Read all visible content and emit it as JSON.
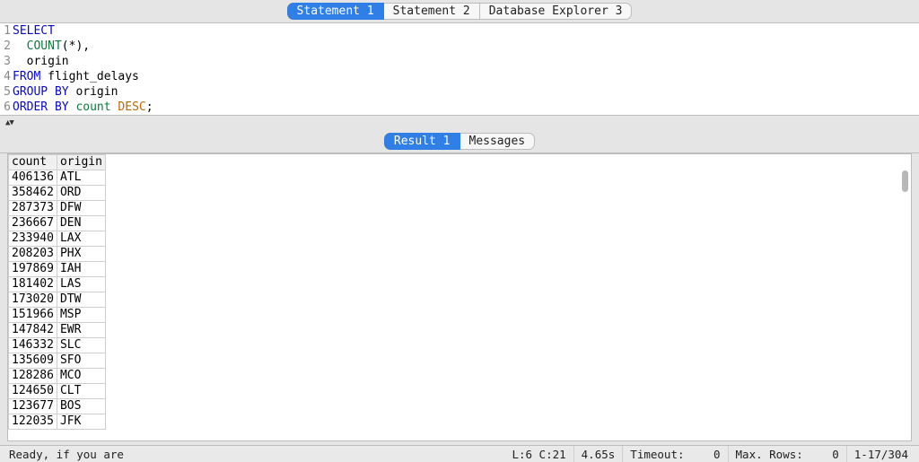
{
  "top_tabs": [
    {
      "label": "Statement 1",
      "active": true
    },
    {
      "label": "Statement 2",
      "active": false
    },
    {
      "label": "Database Explorer 3",
      "active": false
    }
  ],
  "code": {
    "lines": [
      {
        "no": "1",
        "seg": [
          {
            "t": "SELECT",
            "c": "kw-blue"
          }
        ]
      },
      {
        "no": "2",
        "seg": [
          {
            "t": "  ",
            "c": "plain"
          },
          {
            "t": "COUNT",
            "c": "kw-green"
          },
          {
            "t": "(*),",
            "c": "plain"
          }
        ]
      },
      {
        "no": "3",
        "seg": [
          {
            "t": "  origin",
            "c": "plain"
          }
        ]
      },
      {
        "no": "4",
        "seg": [
          {
            "t": "FROM",
            "c": "kw-blue"
          },
          {
            "t": " flight_delays",
            "c": "plain"
          }
        ]
      },
      {
        "no": "5",
        "seg": [
          {
            "t": "GROUP BY",
            "c": "kw-blue"
          },
          {
            "t": " origin",
            "c": "plain"
          }
        ]
      },
      {
        "no": "6",
        "seg": [
          {
            "t": "ORDER BY",
            "c": "kw-blue"
          },
          {
            "t": " ",
            "c": "plain"
          },
          {
            "t": "count",
            "c": "kw-green"
          },
          {
            "t": " ",
            "c": "plain"
          },
          {
            "t": "DESC",
            "c": "kw-orange"
          },
          {
            "t": ";",
            "c": "plain"
          }
        ]
      }
    ]
  },
  "result_tabs": [
    {
      "label": "Result 1",
      "active": true
    },
    {
      "label": "Messages",
      "active": false
    }
  ],
  "result": {
    "columns": [
      "count",
      "origin"
    ],
    "rows": [
      [
        "406136",
        "ATL"
      ],
      [
        "358462",
        "ORD"
      ],
      [
        "287373",
        "DFW"
      ],
      [
        "236667",
        "DEN"
      ],
      [
        "233940",
        "LAX"
      ],
      [
        "208203",
        "PHX"
      ],
      [
        "197869",
        "IAH"
      ],
      [
        "181402",
        "LAS"
      ],
      [
        "173020",
        "DTW"
      ],
      [
        "151966",
        "MSP"
      ],
      [
        "147842",
        "EWR"
      ],
      [
        "146332",
        "SLC"
      ],
      [
        "135609",
        "SFO"
      ],
      [
        "128286",
        "MCO"
      ],
      [
        "124650",
        "CLT"
      ],
      [
        "123677",
        "BOS"
      ],
      [
        "122035",
        "JFK"
      ]
    ]
  },
  "status": {
    "msg": "Ready, if you are",
    "cursor": "L:6 C:21",
    "time": "4.65s",
    "timeout_label": "Timeout:",
    "timeout_val": "0",
    "maxrows_label": "Max. Rows:",
    "maxrows_val": "0",
    "range": "1-17/304"
  }
}
